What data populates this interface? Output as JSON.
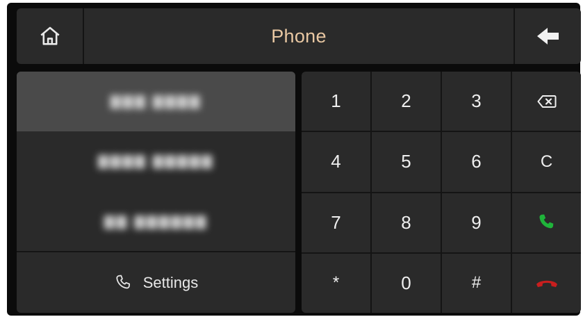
{
  "header": {
    "title": "Phone",
    "home_icon": "home-icon",
    "back_icon": "arrow-left-icon"
  },
  "contacts": {
    "items": [
      {
        "label": "▇▇▇ ▇▇▇▇",
        "selected": true
      },
      {
        "label": "▇▇▇▇ ▇▇▇▇▇"
      },
      {
        "label": "▇▇ ▇▇▇▇▇▇"
      }
    ],
    "settings_label": "Settings",
    "settings_icon": "phone-handset-icon"
  },
  "keypad": {
    "keys": [
      {
        "label": "1"
      },
      {
        "label": "2"
      },
      {
        "label": "3"
      },
      {
        "icon": "backspace-icon"
      },
      {
        "label": "4"
      },
      {
        "label": "5"
      },
      {
        "label": "6"
      },
      {
        "label": "C"
      },
      {
        "label": "7"
      },
      {
        "label": "8"
      },
      {
        "label": "9"
      },
      {
        "icon": "call-icon"
      },
      {
        "label": "*"
      },
      {
        "label": "0"
      },
      {
        "label": "#"
      },
      {
        "icon": "hang-up-icon"
      }
    ]
  },
  "colors": {
    "title": "#e8c7a2",
    "panel": "#2a2a2a",
    "selected": "#4a4a4a",
    "call_green": "#1fb33a",
    "hangup_red": "#c81e1e"
  }
}
